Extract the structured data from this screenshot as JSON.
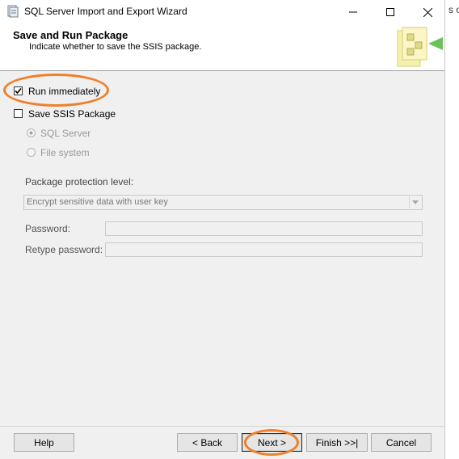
{
  "window": {
    "title": "SQL Server Import and Export Wizard",
    "minimize_glyph": "—",
    "maximize_glyph": "☐",
    "close_glyph": "✕"
  },
  "background_app": {
    "text": "s or"
  },
  "header": {
    "title": "Save and Run Package",
    "subtitle": "Indicate whether to save the SSIS package."
  },
  "options": {
    "run_immediately": {
      "label": "Run immediately",
      "checked": true
    },
    "save_ssis": {
      "label": "Save SSIS Package",
      "checked": false
    },
    "sql_server": {
      "label": "SQL Server",
      "selected": true,
      "enabled": false
    },
    "file_system": {
      "label": "File system",
      "selected": false,
      "enabled": false
    }
  },
  "protection": {
    "label": "Package protection level:",
    "value": "Encrypt sensitive data with user key"
  },
  "password": {
    "label": "Password:",
    "value": ""
  },
  "retype_password": {
    "label": "Retype password:",
    "value": ""
  },
  "footer": {
    "help": "Help",
    "back": "< Back",
    "next": "Next >",
    "finish": "Finish >>|",
    "cancel": "Cancel"
  },
  "colors": {
    "annotation": "#ef7f2a",
    "panel": "#f0f0f0",
    "disabled_text": "#9a9a9a"
  },
  "icons": [
    "wizard-app-icon",
    "package-graphic-icon",
    "check-icon",
    "radio-dot-icon",
    "dropdown-arrow-icon"
  ]
}
